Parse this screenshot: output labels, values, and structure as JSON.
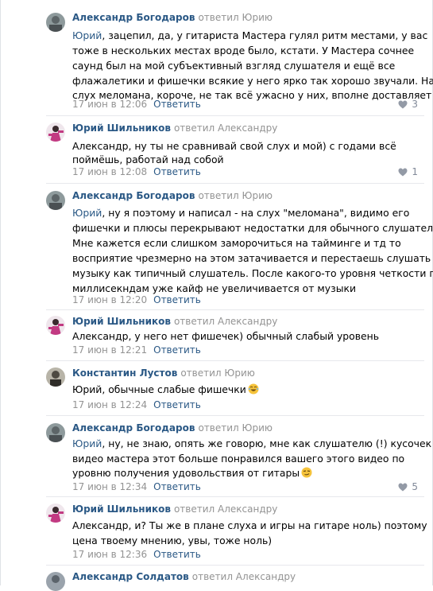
{
  "comments": [
    {
      "author": "Александр Богодаров",
      "replied": "ответил Юрию",
      "lines": [
        {
          "mention": "Юрий",
          "text": ", зацепил, да, у гитариста Мастера гулял ритм местами, у вас"
        },
        {
          "text": "тоже в нескольких местах вроде было, кстати. У Мастера сочнее"
        },
        {
          "text": "саунд был на мой субъективный взгляд слушателя и ещё все"
        },
        {
          "text": "флажалетики и фишечки всякие у него ярко так хорошо звучали. На"
        },
        {
          "text": "слух меломана, короче, не так всё ужасно у них, вполне доставляет"
        }
      ],
      "date": "17 июн в 12:06",
      "reply": "Ответить",
      "likes": "3"
    },
    {
      "author": "Юрий Шильников",
      "replied": "ответил Александру",
      "lines": [
        {
          "text": "Александр, ну ты не сравнивай свой слух и мой) с годами всё"
        },
        {
          "text": "поймёшь, работай над собой"
        }
      ],
      "date": "17 июн в 12:08",
      "reply": "Ответить",
      "likes": "1"
    },
    {
      "author": "Александр Богодаров",
      "replied": "ответил Юрию",
      "lines": [
        {
          "mention": "Юрий",
          "text": ", ну я поэтому и написал - на слух \"меломана\", видимо его"
        },
        {
          "text": "фишечки и плюсы перекрывают недостатки для обычного слушателя."
        },
        {
          "text": "Мне кажется если слишком заморочиться на тайминге и тд то"
        },
        {
          "text": "восприятие чрезмерно на этом затачивается и перестаешь слушать"
        },
        {
          "text": "музыку как типичный слушатель. После какого-то уровня четкости по"
        },
        {
          "text": "миллисекндам уже кайф не увеличивается от музыки"
        }
      ],
      "date": "17 июн в 12:20",
      "reply": "Ответить",
      "likes": ""
    },
    {
      "author": "Юрий Шильников",
      "replied": "ответил Александру",
      "lines": [
        {
          "text": "Александр, у него нет фишечек) обычный слабый уровень"
        }
      ],
      "date": "17 июн в 12:21",
      "reply": "Ответить",
      "likes": ""
    },
    {
      "author": "Константин Лустов",
      "replied": "ответил Юрию",
      "lines": [
        {
          "text": "Юрий, обычные слабые фишечки",
          "emoji": "laugh"
        }
      ],
      "date": "17 июн в 12:24",
      "reply": "Ответить",
      "likes": ""
    },
    {
      "author": "Александр Богодаров",
      "replied": "ответил Юрию",
      "lines": [
        {
          "mention": "Юрий",
          "text": ", ну, не знаю, опять же говорю, мне как слушателю (!) кусочек"
        },
        {
          "text": "видео мастера этот больше понравился вашего этого видео по"
        },
        {
          "text": "уровню получения удовольствия от гитары",
          "emoji": "smirk"
        }
      ],
      "date": "17 июн в 12:34",
      "reply": "Ответить",
      "likes": "5"
    },
    {
      "author": "Юрий Шильников",
      "replied": "ответил Александру",
      "lines": [
        {
          "text": "Александр, и? Ты же в плане слуха и игры на гитаре ноль) поэтому"
        },
        {
          "text": "цена твоему мнению, увы, тоже ноль)"
        }
      ],
      "date": "17 июн в 12:36",
      "reply": "Ответить",
      "likes": ""
    },
    {
      "author": "Александр Солдатов",
      "replied": "ответил Александру",
      "lines": [],
      "date": "",
      "reply": "",
      "likes": ""
    }
  ],
  "colors": {
    "link": "#2a5885",
    "muted": "#939393",
    "separator": "#e7e8ec",
    "emoji": "#f5c33b"
  },
  "icons": {
    "like": "heart-icon",
    "laugh_emoji": "laughing-emoji-icon",
    "smirk_emoji": "smirking-emoji-icon"
  }
}
